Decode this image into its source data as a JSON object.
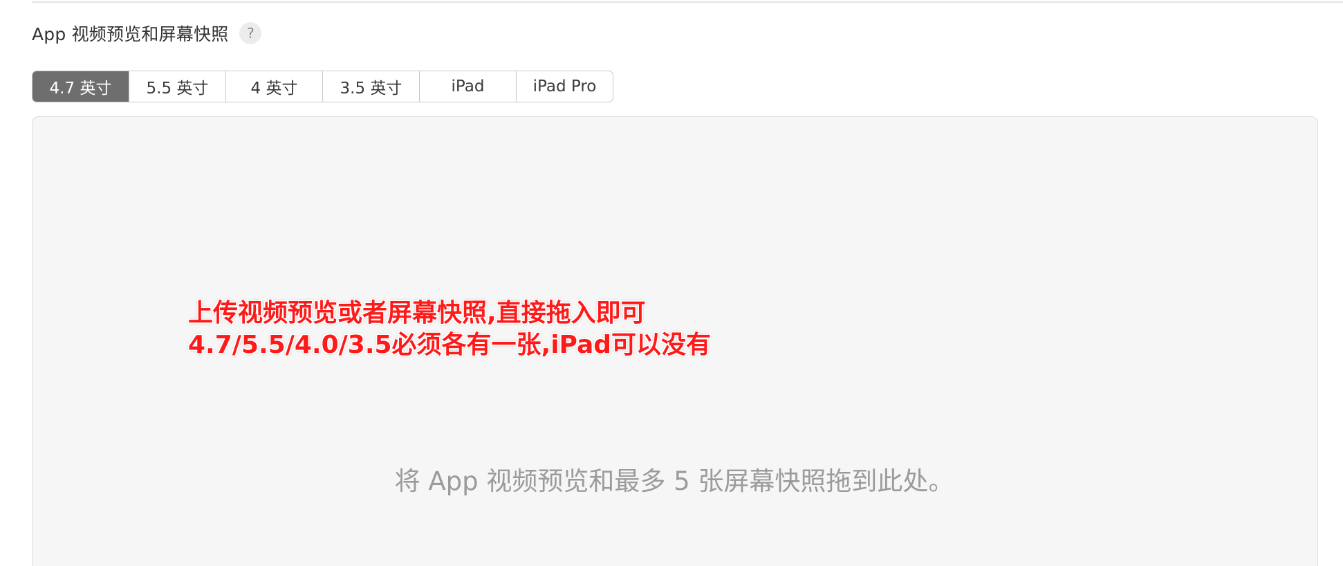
{
  "section": {
    "title": "App 视频预览和屏幕快照",
    "help_label": "?"
  },
  "tabs": [
    {
      "label": "4.7 英寸",
      "active": true
    },
    {
      "label": "5.5 英寸",
      "active": false
    },
    {
      "label": "4 英寸",
      "active": false
    },
    {
      "label": "3.5 英寸",
      "active": false
    },
    {
      "label": "iPad",
      "active": false
    },
    {
      "label": "iPad Pro",
      "active": false
    }
  ],
  "annotation": {
    "line1": "上传视频预览或者屏幕快照,直接拖入即可",
    "line2": "4.7/5.5/4.0/3.5必须各有一张,iPad可以没有",
    "color": "#ff1a1a"
  },
  "dropzone": {
    "hint": "将 App 视频预览和最多 5 张屏幕快照拖到此处。"
  },
  "colors": {
    "active_tab_bg": "#6e6e6e",
    "dropzone_bg": "#f6f6f6"
  }
}
